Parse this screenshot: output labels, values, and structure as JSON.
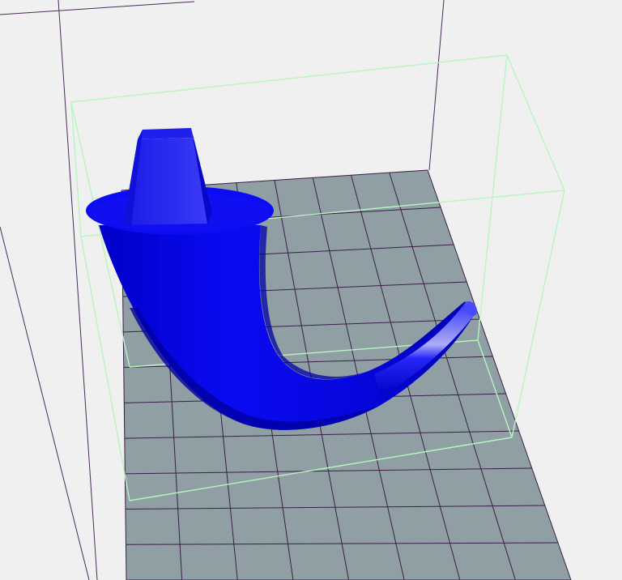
{
  "viewport": {
    "background_color": "#f0f0f0",
    "build_plate_color": "#8f9fa3",
    "grid_line_color": "#3a1f4a",
    "bounding_box_color": "#b8f5c0",
    "frame_line_color": "#4a2a5e",
    "model_color": "#0a0af2",
    "model_shadow_color": "#0000b0",
    "model_highlight_color": "#8c8cff"
  },
  "model": {
    "shape": "curved horn with flat brim and square peg on top",
    "selected": true
  }
}
